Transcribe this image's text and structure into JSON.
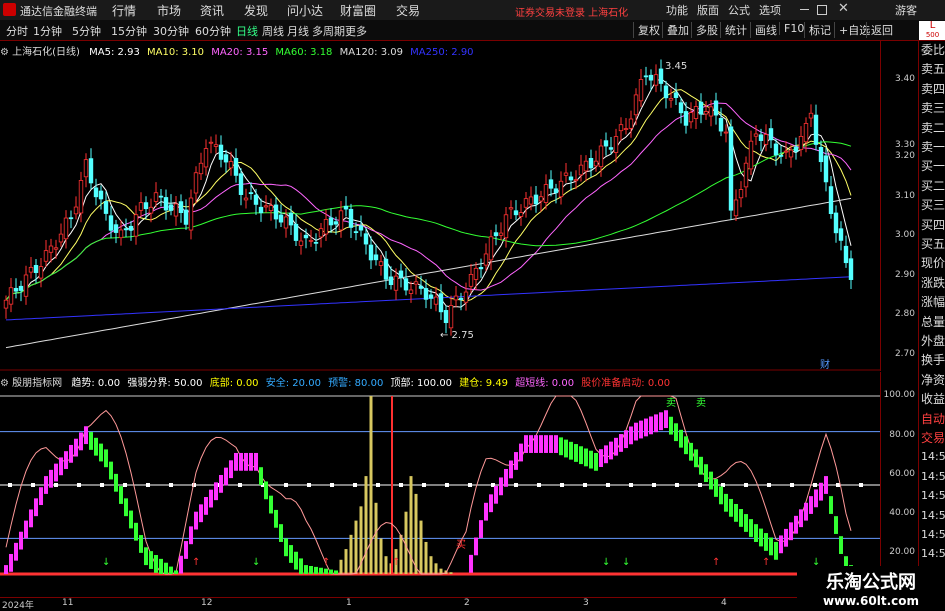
{
  "app": {
    "title": "通达信金融终端",
    "menus": [
      "行情",
      "市场",
      "资讯",
      "发现",
      "问小达",
      "财富圈",
      "交易"
    ],
    "notice": "证券交易未登录  上海石化",
    "right_menus": [
      "功能",
      "版面",
      "公式",
      "选项"
    ],
    "user": "游客"
  },
  "toolbar": {
    "timeframes": [
      "分时",
      "1分钟",
      "5分钟",
      "15分钟",
      "30分钟",
      "60分钟",
      "日线",
      "周线",
      "月线",
      "多周期",
      "更多"
    ],
    "active": "日线",
    "buttons": [
      "复权",
      "叠加",
      "多股",
      "统计",
      "画线",
      "F10",
      "标记",
      "+自选",
      "返回"
    ]
  },
  "main": {
    "stock": "上海石化(日线)",
    "ma": [
      {
        "label": "MA5: 2.93",
        "color": "#ffffff"
      },
      {
        "label": "MA10: 3.10",
        "color": "#ffff66"
      },
      {
        "label": "MA20: 3.15",
        "color": "#ff66ff"
      },
      {
        "label": "MA60: 3.18",
        "color": "#33ff33"
      },
      {
        "label": "MA120: 3.09",
        "color": "#dddddd"
      },
      {
        "label": "MA250: 2.90",
        "color": "#3333ff"
      }
    ],
    "high_label": "3.45",
    "low_label": "2.75",
    "marker": "财",
    "y_ticks": [
      "3.40",
      "3.30",
      "3.20",
      "3.10",
      "3.00",
      "2.90",
      "2.80",
      "2.70"
    ]
  },
  "indicator": {
    "name": "殷朋指标网",
    "items": [
      {
        "t": "趋势: 0.00",
        "c": "#ffffff"
      },
      {
        "t": "强弱分界: 50.00",
        "c": "#ffffff"
      },
      {
        "t": "底部: 0.00",
        "c": "#ffff00"
      },
      {
        "t": "安全: 20.00",
        "c": "#33aaff"
      },
      {
        "t": "预警: 80.00",
        "c": "#33aaff"
      },
      {
        "t": "顶部: 100.00",
        "c": "#ffffff"
      },
      {
        "t": "建仓: 9.49",
        "c": "#ffff00"
      },
      {
        "t": "超短线: 0.00",
        "c": "#ff66ff"
      },
      {
        "t": "股价准备启动: 0.00",
        "c": "#ff3333"
      }
    ],
    "y_ticks": [
      "100.00",
      "80.00",
      "60.00",
      "40.00",
      "20.00"
    ],
    "sell_label": "卖",
    "buy_label": "买"
  },
  "xaxis": [
    "2024年",
    "11",
    "12",
    "1",
    "2",
    "3",
    "4"
  ],
  "right_panel": {
    "badge": "L",
    "badge_sub": "500",
    "labels": [
      "委比",
      "卖五",
      "卖四",
      "卖三",
      "卖二",
      "卖一",
      "买一",
      "买二",
      "买三",
      "买四",
      "买五",
      "现价",
      "涨跌",
      "涨幅",
      "总量",
      "外盘",
      "换手",
      "净资",
      "收益",
      "自动",
      "交易",
      "14:56",
      "14:56",
      "14:56",
      "14:56",
      "14:56",
      "14:56",
      "14:56"
    ]
  },
  "watermark": {
    "line1": "乐淘公式网",
    "line2": "www.60lt.com"
  }
}
